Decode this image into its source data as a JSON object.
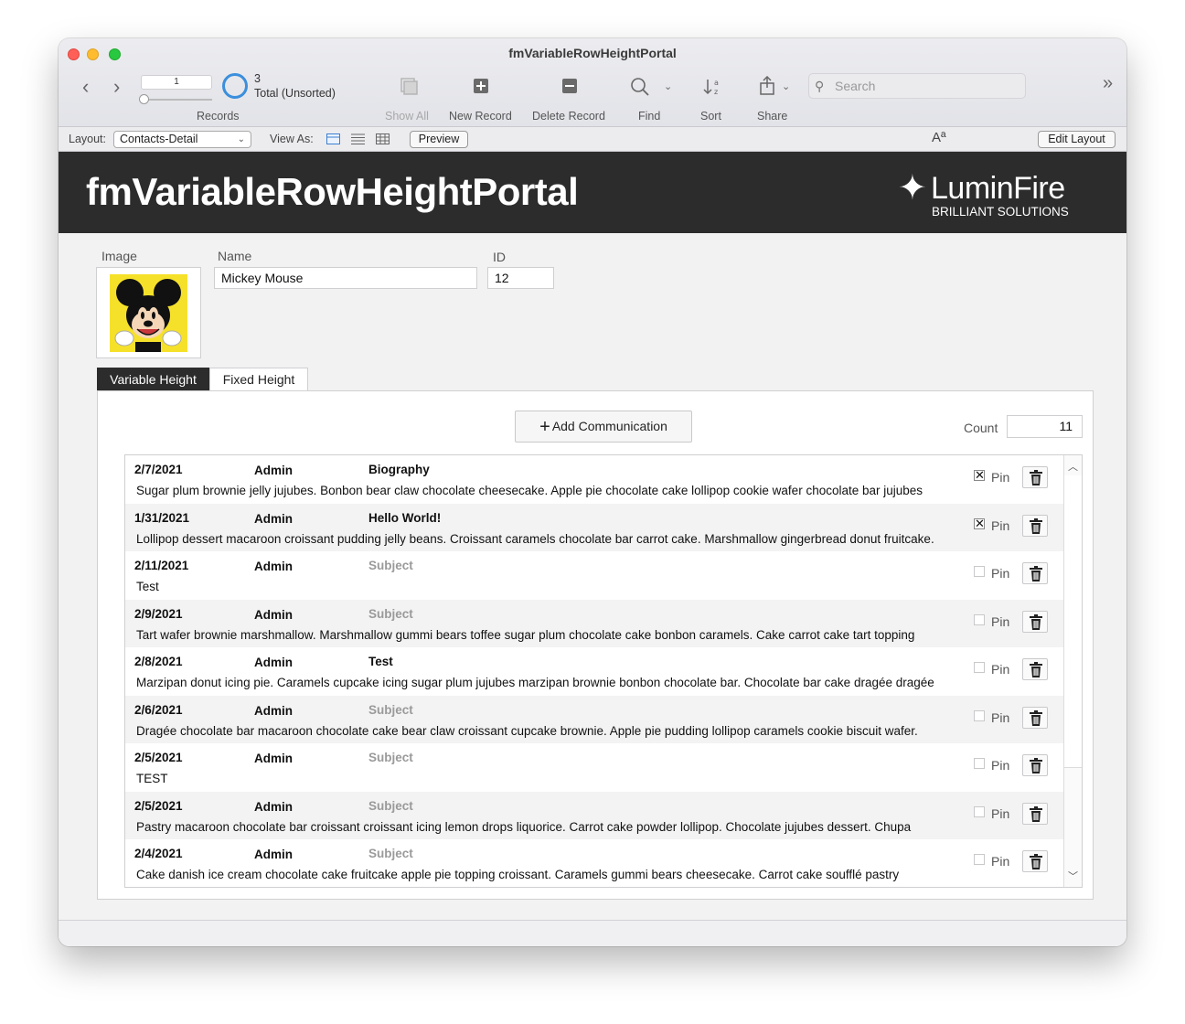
{
  "window": {
    "title": "fmVariableRowHeightPortal"
  },
  "toolbar": {
    "record_number": "1",
    "record_count": "3",
    "record_total_label": "Total (Unsorted)",
    "records_label": "Records",
    "show_all_label": "Show All",
    "new_record_label": "New Record",
    "delete_record_label": "Delete Record",
    "find_label": "Find",
    "sort_label": "Sort",
    "share_label": "Share",
    "search_placeholder": "Search"
  },
  "layoutbar": {
    "layout_label": "Layout:",
    "layout_value": "Contacts-Detail",
    "view_as_label": "View As:",
    "preview_label": "Preview",
    "text_format_glyph": "Aª",
    "edit_layout_label": "Edit Layout"
  },
  "banner": {
    "title": "fmVariableRowHeightPortal",
    "logo_name": "LuminFire",
    "logo_tagline": "BRILLIANT SOLUTIONS"
  },
  "record": {
    "image_label": "Image",
    "name_label": "Name",
    "name_value": "Mickey Mouse",
    "id_label": "ID",
    "id_value": "12"
  },
  "tabs": [
    {
      "label": "Variable Height"
    },
    {
      "label": "Fixed Height"
    }
  ],
  "panel": {
    "add_button_label": "Add Communication",
    "count_label": "Count",
    "count_value": "11"
  },
  "portal": {
    "pin_label": "Pin",
    "rows": [
      {
        "date": "2/7/2021",
        "user": "Admin",
        "subject": "Biography",
        "subject_placeholder": false,
        "body": "Sugar plum brownie jelly jujubes. Bonbon bear claw chocolate cheesecake. Apple pie chocolate cake lollipop cookie wafer chocolate bar jujubes",
        "pinned": true
      },
      {
        "date": "1/31/2021",
        "user": "Admin",
        "subject": "Hello World!",
        "subject_placeholder": false,
        "body": "Lollipop dessert macaroon croissant pudding jelly beans. Croissant caramels chocolate bar carrot cake. Marshmallow gingerbread donut fruitcake.",
        "pinned": true
      },
      {
        "date": "2/11/2021",
        "user": "Admin",
        "subject": "Subject",
        "subject_placeholder": true,
        "body": "Test",
        "pinned": false
      },
      {
        "date": "2/9/2021",
        "user": "Admin",
        "subject": "Subject",
        "subject_placeholder": true,
        "body": "Tart wafer brownie marshmallow. Marshmallow gummi bears toffee sugar plum chocolate cake bonbon caramels. Cake carrot cake tart topping",
        "pinned": false
      },
      {
        "date": "2/8/2021",
        "user": "Admin",
        "subject": "Test",
        "subject_placeholder": false,
        "body": "Marzipan donut icing pie. Caramels cupcake icing sugar plum jujubes marzipan brownie bonbon chocolate bar. Chocolate bar cake dragée dragée",
        "pinned": false
      },
      {
        "date": "2/6/2021",
        "user": "Admin",
        "subject": "Subject",
        "subject_placeholder": true,
        "body": "Dragée chocolate bar macaroon chocolate cake bear claw croissant cupcake brownie. Apple pie pudding lollipop caramels cookie biscuit wafer.",
        "pinned": false
      },
      {
        "date": "2/5/2021",
        "user": "Admin",
        "subject": "Subject",
        "subject_placeholder": true,
        "body": "TEST",
        "pinned": false
      },
      {
        "date": "2/5/2021",
        "user": "Admin",
        "subject": "Subject",
        "subject_placeholder": true,
        "body": "Pastry macaroon chocolate bar croissant croissant icing lemon drops liquorice. Carrot cake powder lollipop. Chocolate jujubes dessert. Chupa",
        "pinned": false
      },
      {
        "date": "2/4/2021",
        "user": "Admin",
        "subject": "Subject",
        "subject_placeholder": true,
        "body": "Cake danish ice cream chocolate cake fruitcake apple pie topping croissant. Caramels gummi bears cheesecake. Carrot cake soufflé pastry",
        "pinned": false
      }
    ]
  },
  "colors": {
    "banner_bg": "#2c2c2c",
    "active_tab_bg": "#2c2c2c",
    "record_pie_blue": "#3b8fdc"
  }
}
